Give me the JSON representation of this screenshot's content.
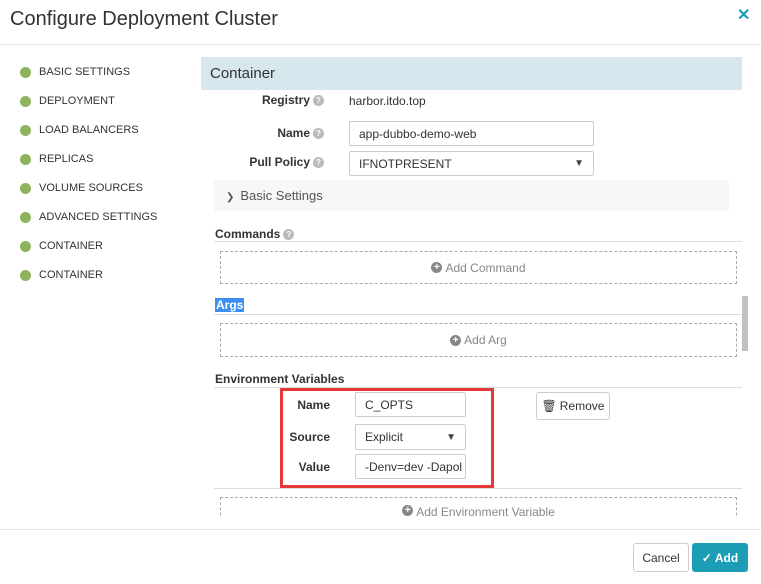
{
  "dialog": {
    "title": "Configure Deployment Cluster",
    "close_icon": "close-icon"
  },
  "sidebar": {
    "items": [
      {
        "label": "BASIC SETTINGS"
      },
      {
        "label": "DEPLOYMENT"
      },
      {
        "label": "LOAD BALANCERS"
      },
      {
        "label": "REPLICAS"
      },
      {
        "label": "VOLUME SOURCES"
      },
      {
        "label": "ADVANCED SETTINGS"
      },
      {
        "label": "CONTAINER"
      },
      {
        "label": "CONTAINER"
      }
    ]
  },
  "container": {
    "title": "Container",
    "registry_label": "Registry",
    "registry_value": "harbor.itdo.top",
    "name_label": "Name",
    "name_value": "app-dubbo-demo-web",
    "pull_label": "Pull Policy",
    "pull_value": "IFNOTPRESENT",
    "basic_settings": "Basic Settings",
    "commands_label": "Commands",
    "add_command": "Add Command",
    "args_label": "Args",
    "add_arg": "Add Arg",
    "env_label": "Environment Variables",
    "env": {
      "name_label": "Name",
      "name_value": "C_OPTS",
      "source_label": "Source",
      "source_value": "Explicit",
      "value_label": "Value",
      "value_value": "-Denv=dev -Dapol",
      "remove": "Remove"
    },
    "add_env": "Add Environment Variable"
  },
  "footer": {
    "cancel": "Cancel",
    "add": "Add"
  },
  "colors": {
    "accent": "#1a9db5",
    "highlight": "#e53935",
    "dot": "#8db35c"
  }
}
